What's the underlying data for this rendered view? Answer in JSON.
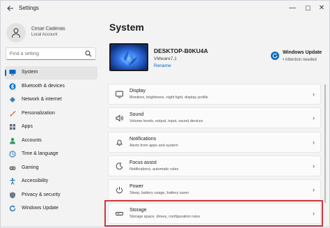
{
  "titlebar": {
    "app_title": "Settings",
    "back_icon": "back-arrow-icon",
    "minimize": "—",
    "maximize": "☐",
    "close": "✕"
  },
  "user": {
    "name": "Cesar Cadenas",
    "account": "Local Account"
  },
  "search": {
    "placeholder": "Find a setting"
  },
  "nav": {
    "items": [
      {
        "label": "System",
        "icon": "monitor-icon",
        "color": "#0067c0",
        "selected": true
      },
      {
        "label": "Bluetooth & devices",
        "icon": "bluetooth-icon",
        "color": "#0078d4"
      },
      {
        "label": "Network & internet",
        "icon": "network-icon",
        "color": "#3a7fc2"
      },
      {
        "label": "Personalization",
        "icon": "brush-icon",
        "color": "#d86b2c"
      },
      {
        "label": "Apps",
        "icon": "apps-icon",
        "color": "#5a6b7d"
      },
      {
        "label": "Accounts",
        "icon": "person-icon",
        "color": "#2f9a5e"
      },
      {
        "label": "Time & language",
        "icon": "globe-clock-icon",
        "color": "#3b82c4"
      },
      {
        "label": "Gaming",
        "icon": "gamepad-icon",
        "color": "#777777"
      },
      {
        "label": "Accessibility",
        "icon": "accessibility-icon",
        "color": "#1e6fbf"
      },
      {
        "label": "Privacy & security",
        "icon": "shield-icon",
        "color": "#707a86"
      },
      {
        "label": "Windows Update",
        "icon": "update-icon",
        "color": "#0f6cbd"
      }
    ]
  },
  "main": {
    "title": "System",
    "device": {
      "name": "DESKTOP-B0KU4A",
      "model": "VMware7,1",
      "rename": "Rename"
    },
    "windows_update": {
      "title": "Windows Update",
      "status": "• Attention needed"
    },
    "cards": [
      {
        "title": "Display",
        "desc": "Monitors, brightness, night light, display profile",
        "icon": "display-icon"
      },
      {
        "title": "Sound",
        "desc": "Volume levels, output, input, sound devices",
        "icon": "speaker-icon"
      },
      {
        "title": "Notifications",
        "desc": "Alerts from apps and system",
        "icon": "bell-icon"
      },
      {
        "title": "Focus assist",
        "desc": "Notifications, automatic rules",
        "icon": "moon-icon"
      },
      {
        "title": "Power",
        "desc": "Sleep, battery usage, battery saver",
        "icon": "power-icon"
      },
      {
        "title": "Storage",
        "desc": "Storage space, drives, configuration rules",
        "icon": "drive-icon"
      }
    ],
    "chevron": "›"
  },
  "colors": {
    "accent": "#0067c0",
    "highlight": "#d0343c"
  }
}
